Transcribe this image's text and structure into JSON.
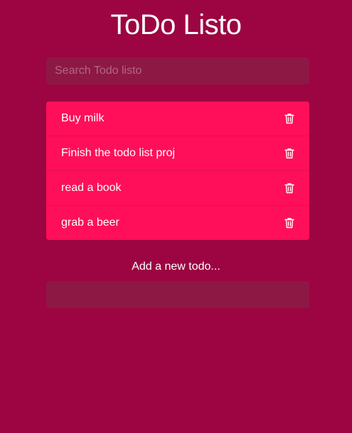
{
  "app": {
    "title": "ToDo Listo"
  },
  "search": {
    "placeholder": "Search Todo listo",
    "value": ""
  },
  "todos": [
    {
      "text": "Buy milk",
      "action_icon": "trash-icon"
    },
    {
      "text": "Finish the todo list proj",
      "action_icon": "trash-icon"
    },
    {
      "text": "read a book",
      "action_icon": "trash-icon"
    },
    {
      "text": "grab a beer",
      "action_icon": "trash-icon"
    }
  ],
  "add": {
    "label": "Add a new todo...",
    "value": ""
  },
  "colors": {
    "background": "#9c0542",
    "item_background": "#ff0f5a",
    "input_background": "#8d1844",
    "text": "#ffffff"
  }
}
